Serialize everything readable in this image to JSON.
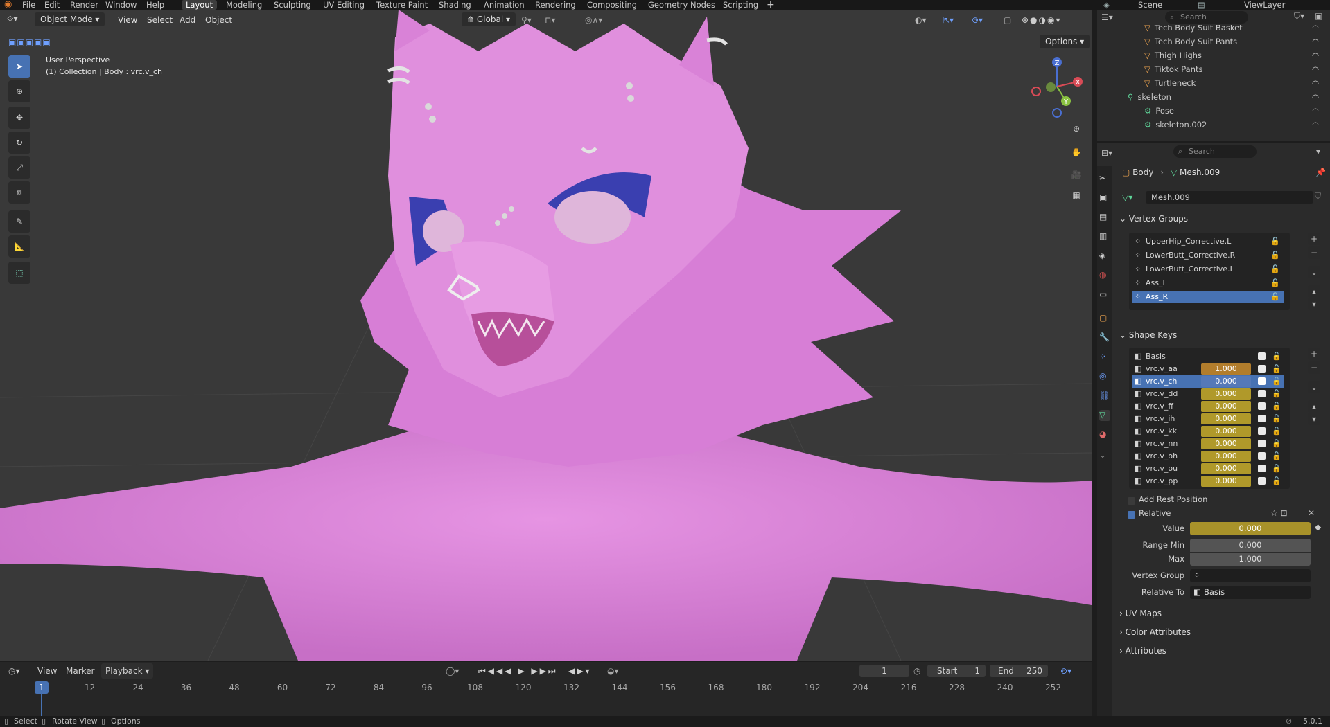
{
  "app": {
    "menu": [
      "File",
      "Edit",
      "Render",
      "Window",
      "Help"
    ],
    "workspaces": [
      "Layout",
      "Modeling",
      "Sculpting",
      "UV Editing",
      "Texture Paint",
      "Shading",
      "Animation",
      "Rendering",
      "Compositing",
      "Geometry Nodes",
      "Scripting"
    ],
    "scene": "Scene",
    "view_layer": "ViewLayer",
    "search_placeholder": "Search"
  },
  "viewport": {
    "mode": "Object Mode",
    "menus": [
      "View",
      "Select",
      "Add",
      "Object"
    ],
    "transform_orientation": "Global",
    "options_label": "Options",
    "info_line1": "User Perspective",
    "info_line2": "(1) Collection | Body : vrc.v_ch",
    "gizmo": {
      "z": "Z",
      "y": "Y",
      "x": "X"
    }
  },
  "outliner": {
    "items": [
      {
        "label": "Tech Body Suit Basket",
        "indent": 4
      },
      {
        "label": "Tech Body Suit Pants",
        "indent": 4
      },
      {
        "label": "Thigh Highs",
        "indent": 4
      },
      {
        "label": "Tiktok Pants",
        "indent": 4
      },
      {
        "label": "Turtleneck",
        "indent": 4
      },
      {
        "label": "skeleton",
        "indent": 2
      },
      {
        "label": "Pose",
        "indent": 4
      },
      {
        "label": "skeleton.002",
        "indent": 4
      }
    ]
  },
  "properties": {
    "search_placeholder": "Search",
    "breadcrumb": {
      "object": "Body",
      "mesh": "Mesh.009"
    },
    "mesh_name": "Mesh.009",
    "vertex_groups": {
      "title": "Vertex Groups",
      "items": [
        "UpperHip_Corrective.L",
        "LowerButt_Corrective.R",
        "LowerButt_Corrective.L",
        "Ass_L",
        "Ass_R"
      ],
      "selected": 4
    },
    "shape_keys": {
      "title": "Shape Keys",
      "items": [
        {
          "name": "Basis",
          "value": ""
        },
        {
          "name": "vrc.v_aa",
          "value": "1.000"
        },
        {
          "name": "vrc.v_ch",
          "value": "0.000"
        },
        {
          "name": "vrc.v_dd",
          "value": "0.000"
        },
        {
          "name": "vrc.v_ff",
          "value": "0.000"
        },
        {
          "name": "vrc.v_ih",
          "value": "0.000"
        },
        {
          "name": "vrc.v_kk",
          "value": "0.000"
        },
        {
          "name": "vrc.v_nn",
          "value": "0.000"
        },
        {
          "name": "vrc.v_oh",
          "value": "0.000"
        },
        {
          "name": "vrc.v_ou",
          "value": "0.000"
        },
        {
          "name": "vrc.v_pp",
          "value": "0.000"
        }
      ],
      "selected": 2,
      "add_rest_position": "Add Rest Position",
      "relative": "Relative",
      "value_label": "Value",
      "value": "0.000",
      "range_min_label": "Range Min",
      "range_min": "0.000",
      "max_label": "Max",
      "max": "1.000",
      "vertex_group_label": "Vertex Group",
      "vertex_group": "",
      "relative_to_label": "Relative To",
      "relative_to": "Basis"
    },
    "collapsed_panels": [
      "UV Maps",
      "Color Attributes",
      "Attributes"
    ]
  },
  "timeline": {
    "menus": [
      "View",
      "Marker",
      "Playback"
    ],
    "current_frame": "1",
    "start_label": "Start",
    "start": "1",
    "end_label": "End",
    "end": "250",
    "ticks": [
      "1",
      "12",
      "24",
      "36",
      "48",
      "60",
      "72",
      "84",
      "96",
      "108",
      "120",
      "132",
      "144",
      "156",
      "168",
      "180",
      "192",
      "204",
      "216",
      "228",
      "240",
      "252"
    ]
  },
  "statusbar": {
    "select": "Select",
    "rotate": "Rotate View",
    "options": "Options",
    "version": "5.0.1"
  },
  "colors": {
    "accent": "#4772b3",
    "keyed_value": "#b0992a",
    "active_value": "#b27d2c",
    "model_pink": "#d97fd7"
  }
}
